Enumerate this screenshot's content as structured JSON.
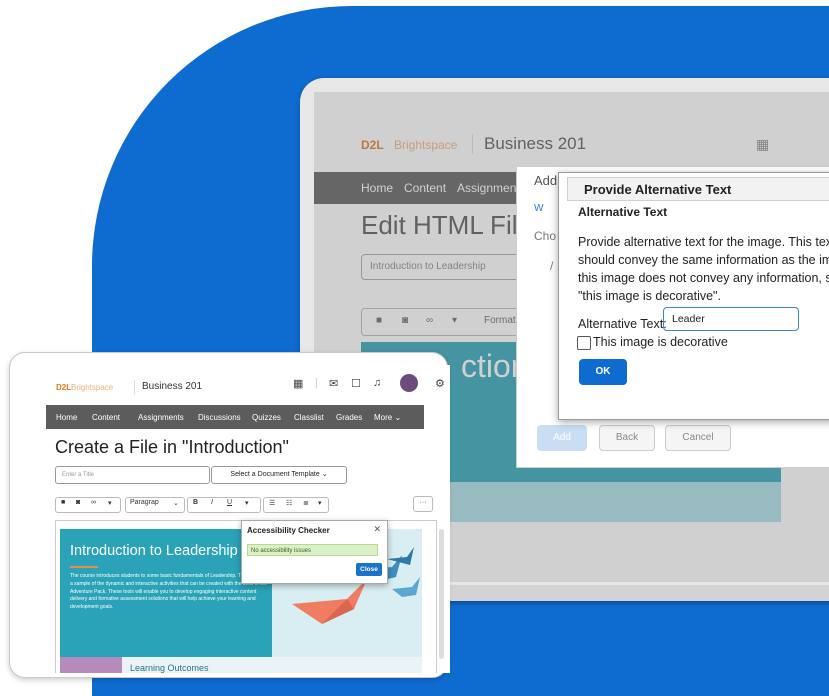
{
  "colors": {
    "brand_blue": "#0e6cd0",
    "d2l_orange": "#e07a1f",
    "nav_gray": "#5c5c5c",
    "teal": "#2aa3b8"
  },
  "laptop": {
    "brand": {
      "d2l": "D2L",
      "brightspace": "Brightspace"
    },
    "course": "Business 201",
    "nav": [
      "Home",
      "Content",
      "Assignment"
    ],
    "page_title": "Edit HTML File",
    "title_value": "Introduction to Leadership",
    "toolbar": {
      "format_label": "Format"
    },
    "hero_fragment": "ction",
    "bg_dialog": {
      "title": "Add",
      "web_label": "W",
      "choose_label": "Cho",
      "slash": "/"
    },
    "buttons": {
      "add": "Add",
      "back": "Back",
      "cancel": "Cancel"
    },
    "alt_dialog": {
      "title": "Provide Alternative Text",
      "subtitle": "Alternative Text",
      "description_lines": [
        "Provide alternative text for the image. This text",
        "should convey the same information as the image.",
        "this image does not convey any information, selec",
        "\"this image is decorative\"."
      ],
      "field_label": "Alternative Text:",
      "field_value": "Leader",
      "decorative_label": "This image is decorative",
      "ok_label": "OK"
    }
  },
  "tablet": {
    "brand": {
      "d2l": "D2L",
      "brightspace": "Brightspace"
    },
    "course": "Business 201",
    "nav": [
      "Home",
      "Content",
      "Assignments",
      "Discussions",
      "Quizzes",
      "Classlist",
      "Grades",
      "More ⌄"
    ],
    "page_title": "Create a File in \"Introduction\"",
    "title_placeholder": "Enter a Title",
    "template_button": "Select a Document Template ⌄",
    "toolbar": {
      "paragraph": "Paragrap",
      "bold": "B",
      "italic": "I",
      "underline": "U"
    },
    "hero": {
      "heading": "Introduction to Leadership",
      "body": "The course introduces students to some basic fundamentals of Leadership. This course is a sample of the dynamic and interactive activities that can be created with the tools in the Adventure Pack. These tools will enable you to develop engaging interactive content delivery and formative assessment solutions that will help achieve your learning and development goals."
    },
    "section_heading": "Learning Outcomes",
    "checker": {
      "title": "Accessibility Checker",
      "message": "No accessibility issues",
      "close": "Close"
    }
  }
}
